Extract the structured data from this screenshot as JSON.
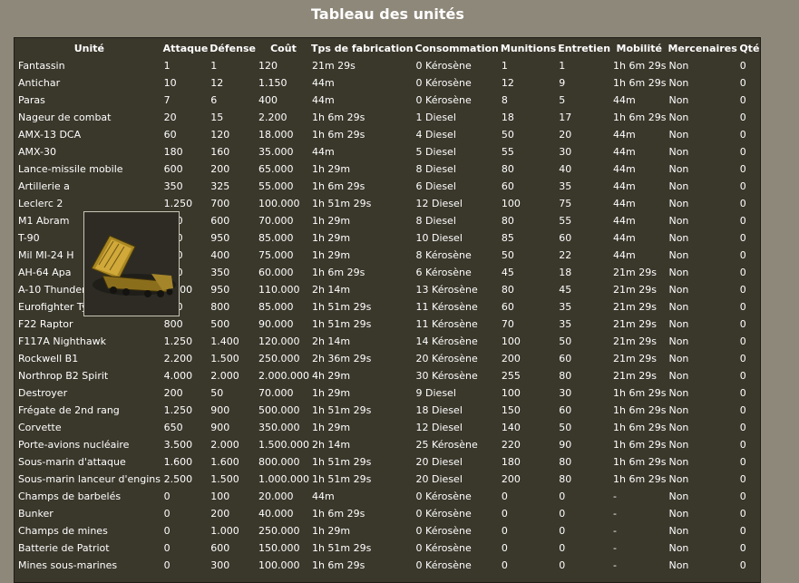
{
  "title": "Tableau des unités",
  "columns": [
    "Unité",
    "Attaque",
    "Défense",
    "Coût",
    "Tps de fabrication",
    "Consommation",
    "Munitions",
    "Entretien",
    "Mobilité",
    "Mercenaires",
    "Qté"
  ],
  "tooltip_icon": "patriot-missile-launcher-icon",
  "rows": [
    [
      "Fantassin",
      "1",
      "1",
      "120",
      "21m 29s",
      "0 Kérosène",
      "1",
      "1",
      "1h 6m 29s",
      "Non",
      "0"
    ],
    [
      "Antichar",
      "10",
      "12",
      "1.150",
      "44m",
      "0 Kérosène",
      "12",
      "9",
      "1h 6m 29s",
      "Non",
      "0"
    ],
    [
      "Paras",
      "7",
      "6",
      "400",
      "44m",
      "0 Kérosène",
      "8",
      "5",
      "44m",
      "Non",
      "0"
    ],
    [
      "Nageur de combat",
      "20",
      "15",
      "2.200",
      "1h 6m 29s",
      "1 Diesel",
      "18",
      "17",
      "1h 6m 29s",
      "Non",
      "0"
    ],
    [
      "AMX-13 DCA",
      "60",
      "120",
      "18.000",
      "1h 6m 29s",
      "4 Diesel",
      "50",
      "20",
      "44m",
      "Non",
      "0"
    ],
    [
      "AMX-30",
      "180",
      "160",
      "35.000",
      "44m",
      "5 Diesel",
      "55",
      "30",
      "44m",
      "Non",
      "0"
    ],
    [
      "Lance-missile mobile",
      "600",
      "200",
      "65.000",
      "1h 29m",
      "8 Diesel",
      "80",
      "40",
      "44m",
      "Non",
      "0"
    ],
    [
      "Artillerie a",
      "350",
      "325",
      "55.000",
      "1h 6m 29s",
      "6 Diesel",
      "60",
      "35",
      "44m",
      "Non",
      "0"
    ],
    [
      "Leclerc 2",
      "1.250",
      "700",
      "100.000",
      "1h 51m 29s",
      "12 Diesel",
      "100",
      "75",
      "44m",
      "Non",
      "0"
    ],
    [
      "M1 Abram",
      "750",
      "600",
      "70.000",
      "1h 29m",
      "8 Diesel",
      "80",
      "55",
      "44m",
      "Non",
      "0"
    ],
    [
      "T-90",
      "800",
      "950",
      "85.000",
      "1h 29m",
      "10 Diesel",
      "85",
      "60",
      "44m",
      "Non",
      "0"
    ],
    [
      "Mil MI-24 H",
      "600",
      "400",
      "75.000",
      "1h 29m",
      "8 Kérosène",
      "50",
      "22",
      "44m",
      "Non",
      "0"
    ],
    [
      "AH-64 Apa",
      "400",
      "350",
      "60.000",
      "1h 6m 29s",
      "6 Kérosène",
      "45",
      "18",
      "21m 29s",
      "Non",
      "0"
    ],
    [
      "A-10 Thunderbolt",
      "1.100",
      "950",
      "110.000",
      "2h 14m",
      "13 Kérosène",
      "80",
      "45",
      "21m 29s",
      "Non",
      "0"
    ],
    [
      "Eurofighter Typhoon",
      "400",
      "800",
      "85.000",
      "1h 51m 29s",
      "11 Kérosène",
      "60",
      "35",
      "21m 29s",
      "Non",
      "0"
    ],
    [
      "F22 Raptor",
      "800",
      "500",
      "90.000",
      "1h 51m 29s",
      "11 Kérosène",
      "70",
      "35",
      "21m 29s",
      "Non",
      "0"
    ],
    [
      "F117A Nighthawk",
      "1.250",
      "1.400",
      "120.000",
      "2h 14m",
      "14 Kérosène",
      "100",
      "50",
      "21m 29s",
      "Non",
      "0"
    ],
    [
      "Rockwell B1",
      "2.200",
      "1.500",
      "250.000",
      "2h 36m 29s",
      "20 Kérosène",
      "200",
      "60",
      "21m 29s",
      "Non",
      "0"
    ],
    [
      "Northrop B2 Spirit",
      "4.000",
      "2.000",
      "2.000.000",
      "4h 29m",
      "30 Kérosène",
      "255",
      "80",
      "21m 29s",
      "Non",
      "0"
    ],
    [
      "Destroyer",
      "200",
      "50",
      "70.000",
      "1h 29m",
      "9 Diesel",
      "100",
      "30",
      "1h 6m 29s",
      "Non",
      "0"
    ],
    [
      "Frégate de 2nd rang",
      "1.250",
      "900",
      "500.000",
      "1h 51m 29s",
      "18 Diesel",
      "150",
      "60",
      "1h 6m 29s",
      "Non",
      "0"
    ],
    [
      "Corvette",
      "650",
      "900",
      "350.000",
      "1h 29m",
      "12 Diesel",
      "140",
      "50",
      "1h 6m 29s",
      "Non",
      "0"
    ],
    [
      "Porte-avions nucléaire",
      "3.500",
      "2.000",
      "1.500.000",
      "2h 14m",
      "25 Kérosène",
      "220",
      "90",
      "1h 6m 29s",
      "Non",
      "0"
    ],
    [
      "Sous-marin d'attaque",
      "1.600",
      "1.600",
      "800.000",
      "1h 51m 29s",
      "20 Diesel",
      "180",
      "80",
      "1h 6m 29s",
      "Non",
      "0"
    ],
    [
      "Sous-marin lanceur d'engins",
      "2.500",
      "1.500",
      "1.000.000",
      "1h 51m 29s",
      "20 Diesel",
      "200",
      "80",
      "1h 6m 29s",
      "Non",
      "0"
    ],
    [
      "Champs de barbelés",
      "0",
      "100",
      "20.000",
      "44m",
      "0 Kérosène",
      "0",
      "0",
      "-",
      "Non",
      "0"
    ],
    [
      "Bunker",
      "0",
      "200",
      "40.000",
      "1h 6m 29s",
      "0 Kérosène",
      "0",
      "0",
      "-",
      "Non",
      "0"
    ],
    [
      "Champs de mines",
      "0",
      "1.000",
      "250.000",
      "1h 29m",
      "0 Kérosène",
      "0",
      "0",
      "-",
      "Non",
      "0"
    ],
    [
      "Batterie de Patriot",
      "0",
      "600",
      "150.000",
      "1h 51m 29s",
      "0 Kérosène",
      "0",
      "0",
      "-",
      "Non",
      "0"
    ],
    [
      "Mines sous-marines",
      "0",
      "300",
      "100.000",
      "1h 6m 29s",
      "0 Kérosène",
      "0",
      "0",
      "-",
      "Non",
      "0"
    ]
  ]
}
